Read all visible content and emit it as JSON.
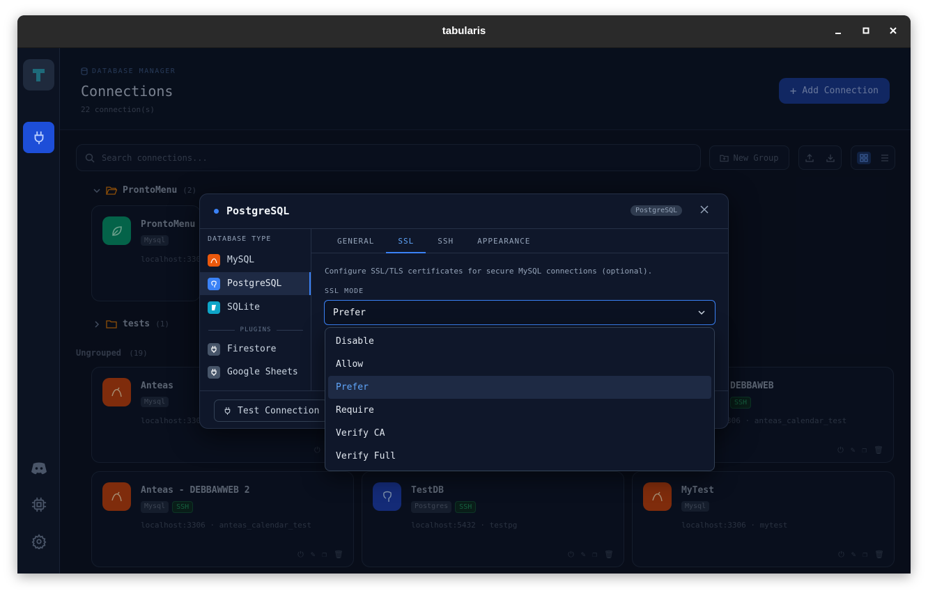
{
  "window": {
    "title": "tabularis"
  },
  "header": {
    "eyebrow": "DATABASE MANAGER",
    "title": "Connections",
    "subtitle": "22 connection(s)",
    "add_button": "Add Connection"
  },
  "toolbar": {
    "search_placeholder": "Search connections...",
    "new_group": "New Group"
  },
  "groups": [
    {
      "name": "ProntoMenu",
      "count": "(2)",
      "expanded": true
    },
    {
      "name": "tests",
      "count": "(1)",
      "expanded": false
    }
  ],
  "ungrouped": {
    "label": "Ungrouped",
    "count": "(19)"
  },
  "cards": {
    "prontomenu": {
      "name": "ProntoMenu",
      "tag": "Mysql",
      "host": "localhost:330"
    },
    "anteas": {
      "name": "Anteas",
      "tag": "Mysql",
      "host": "localhost:330"
    },
    "debbaweb": {
      "name": "DEBBAWEB",
      "ssh": "SSH",
      "host": "306 · anteas_calendar_test"
    },
    "anteas2": {
      "name": "Anteas - DEBBAWWEB 2",
      "tag": "Mysql",
      "ssh": "SSH",
      "host": "localhost:3306 · anteas_calendar_test"
    },
    "testdb": {
      "name": "TestDB",
      "tag": "Postgres",
      "ssh": "SSH",
      "host": "localhost:5432 · testpg"
    },
    "mytest": {
      "name": "MyTest",
      "tag": "Mysql",
      "host": "localhost:3306 · mytest"
    }
  },
  "modal": {
    "title": "PostgreSQL",
    "badge": "PostgreSQL",
    "db_type_label": "DATABASE TYPE",
    "db_types": [
      "MySQL",
      "PostgreSQL",
      "SQLite"
    ],
    "plugins_label": "PLUGINS",
    "plugins": [
      "Firestore",
      "Google Sheets"
    ],
    "tabs": [
      "GENERAL",
      "SSL",
      "SSH",
      "APPEARANCE"
    ],
    "active_tab": "SSL",
    "description": "Configure SSL/TLS certificates for secure MySQL connections (optional).",
    "ssl_mode_label": "SSL MODE",
    "ssl_mode_value": "Prefer",
    "test_button": "Test Connection"
  },
  "dropdown": {
    "options": [
      "Disable",
      "Allow",
      "Prefer",
      "Require",
      "Verify CA",
      "Verify Full"
    ],
    "selected": "Prefer"
  },
  "colors": {
    "accent": "#3b82f6",
    "mysql": "#c2410c",
    "postgres": "#1e40af",
    "sqlite": "#0ea5c8",
    "prontomenu": "#059669"
  }
}
